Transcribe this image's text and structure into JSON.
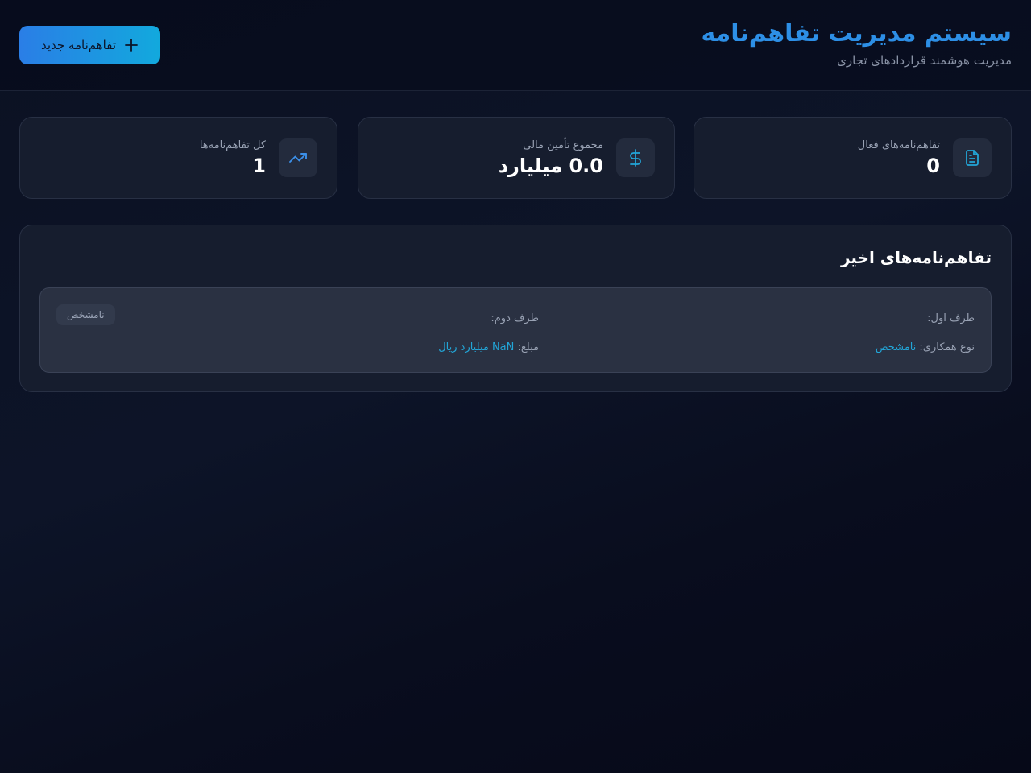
{
  "header": {
    "title": "سیستم مدیریت تفاهم‌نامه",
    "subtitle": "مدیریت هوشمند قراردادهای تجاری",
    "new_button_label": "تفاهم‌نامه جدید",
    "new_button_icon": "plus-icon"
  },
  "stats": [
    {
      "label": "تفاهم‌نامه‌های فعال",
      "value": "0",
      "icon": "document-icon"
    },
    {
      "label": "مجموع تأمین مالی",
      "value": "0.0 میلیارد",
      "icon": "dollar-icon"
    },
    {
      "label": "کل تفاهم‌نامه‌ها",
      "value": "1",
      "icon": "trending-up-icon"
    }
  ],
  "recent": {
    "title": "تفاهم‌نامه‌های اخیر",
    "items": [
      {
        "party1_label": "طرف اول:",
        "party1_value": "",
        "party2_label": "طرف دوم:",
        "party2_value": "",
        "type_label": "نوع همکاری:",
        "type_value": "نامشخص",
        "amount_label": "مبلغ:",
        "amount_value": "NaN میلیارد ریال",
        "status": "نامشخص"
      }
    ]
  },
  "colors": {
    "accent": "#2d8fe6",
    "accent_cyan": "#22a6d8",
    "background": "#0b1122",
    "card": "#161d2e"
  }
}
